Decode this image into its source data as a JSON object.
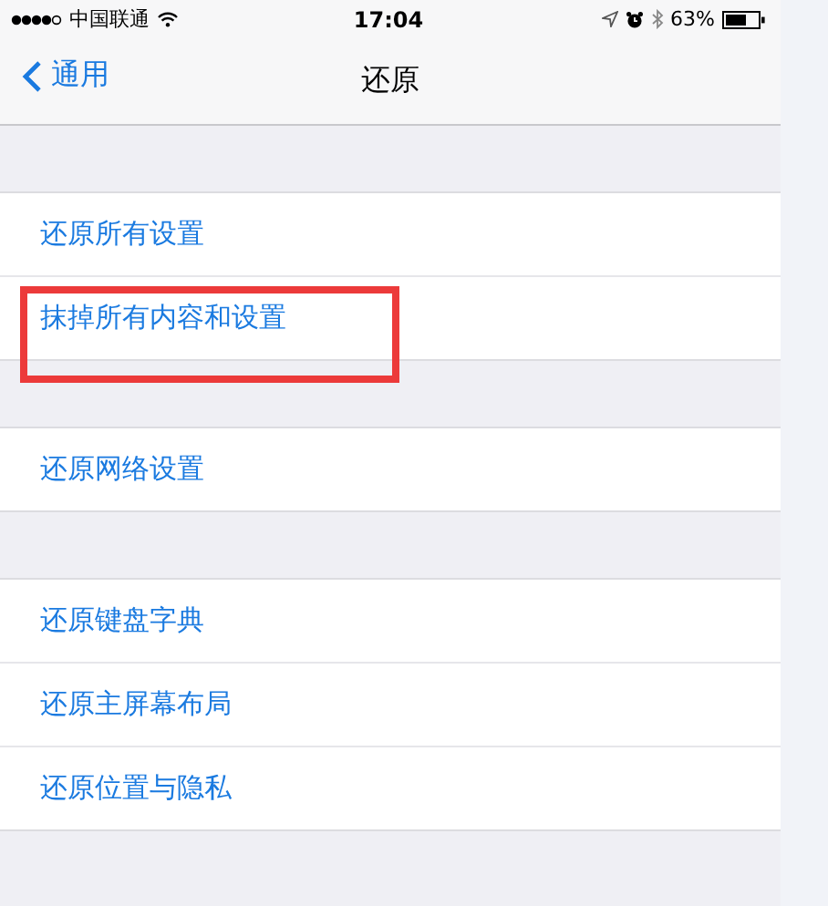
{
  "status_bar": {
    "carrier": "中国联通",
    "time": "17:04",
    "battery": "63%"
  },
  "nav": {
    "back": "通用",
    "title": "还原"
  },
  "groups": [
    {
      "items": [
        {
          "label": "还原所有设置",
          "highlighted": false
        },
        {
          "label": "抹掉所有内容和设置",
          "highlighted": true
        }
      ]
    },
    {
      "items": [
        {
          "label": "还原网络设置",
          "highlighted": false
        }
      ]
    },
    {
      "items": [
        {
          "label": "还原键盘字典",
          "highlighted": false
        },
        {
          "label": "还原主屏幕布局",
          "highlighted": false
        },
        {
          "label": "还原位置与隐私",
          "highlighted": false
        }
      ]
    }
  ]
}
